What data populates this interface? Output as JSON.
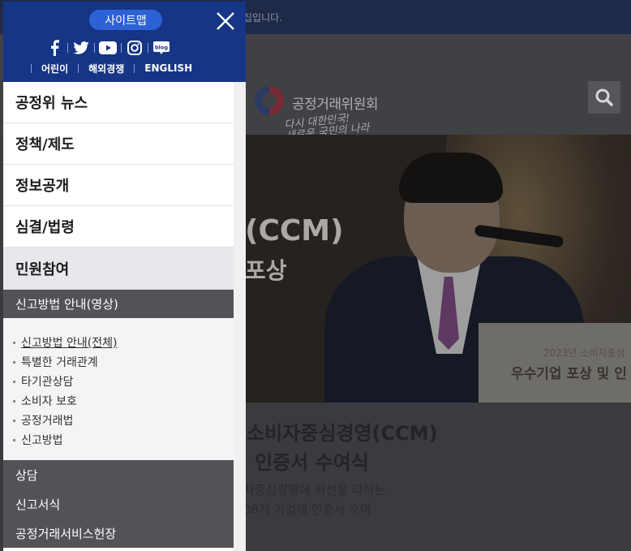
{
  "background": {
    "topbar_text": "집입니다.",
    "org_name": "공정거래위원회",
    "slogan_line1": "다시 대한민국!",
    "slogan_line2": "새로운 국민의 나라",
    "banner_big1": "(CCM)",
    "banner_big2": "포상",
    "podium_label1": "2023년 소비자중심",
    "podium_label2": "우수기업 포상 및 인",
    "news_title_line1": "소비자중심경영(CCM)",
    "news_title_line2": "인증서 수여식",
    "news_desc_line1": "자중심경영에 최선을 다하는",
    "news_desc_line2": "08개 기업에 인증서 수여"
  },
  "panel": {
    "sitemap_label": "사이트맵",
    "close_icon": "close-icon",
    "social_icons": [
      "facebook-icon",
      "twitter-icon",
      "youtube-icon",
      "instagram-icon",
      "blog-icon"
    ],
    "blog_label": "blog",
    "links": [
      "어린이",
      "해외경쟁",
      "ENGLISH"
    ],
    "menu": [
      "공정위 뉴스",
      "정책/제도",
      "정보공개",
      "심결/법령",
      "민원참여"
    ],
    "active_menu": "민원참여",
    "submenu_header": "신고방법 안내(영상)",
    "submenu_links": [
      "신고방법 안내(전체)",
      "특별한 거래관계",
      "타기관상담",
      "소비자 보호",
      "공정거래법",
      "신고방법"
    ],
    "lower_items": [
      "상담",
      "신고서식",
      "공정거래서비스헌장"
    ]
  },
  "colors": {
    "panel_header": "#163586",
    "sitemap_button": "#2d62d6",
    "submenu_dark": "#525257"
  }
}
